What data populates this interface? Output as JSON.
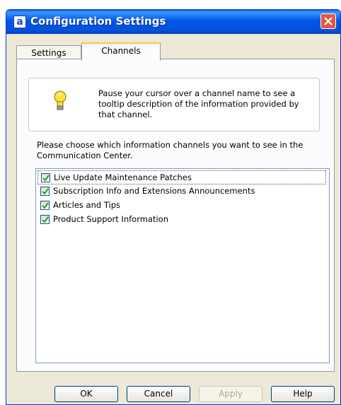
{
  "window": {
    "title": "Configuration Settings",
    "app_icon_glyph": "a"
  },
  "tabs": [
    {
      "label": "Settings",
      "selected": false
    },
    {
      "label": "Channels",
      "selected": true
    }
  ],
  "info": {
    "icon": "lightbulb-icon",
    "text": "Pause your cursor over a channel name to see a tooltip description of the information provided by that channel."
  },
  "prompt": "Please choose which information channels you want to see in the Communication Center.",
  "channels": [
    {
      "label": "Live Update Maintenance Patches",
      "checked": true
    },
    {
      "label": "Subscription Info and Extensions Announcements",
      "checked": true
    },
    {
      "label": "Articles and Tips",
      "checked": true
    },
    {
      "label": "Product Support Information",
      "checked": true
    }
  ],
  "buttons": {
    "ok": "OK",
    "cancel": "Cancel",
    "apply": "Apply",
    "help": "Help"
  },
  "colors": {
    "titlebar": "#0058e6",
    "close": "#e2583e",
    "tab_highlight": "#ffc83c"
  }
}
